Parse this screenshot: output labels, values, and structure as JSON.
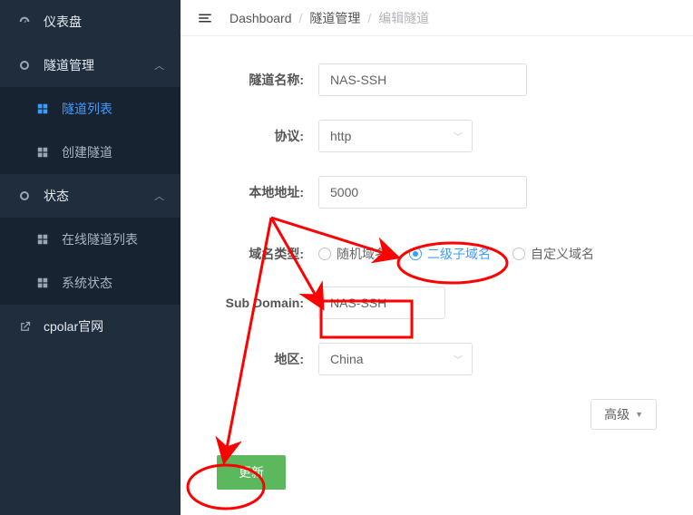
{
  "sidebar": {
    "dashboard": "仪表盘",
    "tunnel_group": "隧道管理",
    "tunnel_list": "隧道列表",
    "tunnel_create": "创建隧道",
    "status_group": "状态",
    "status_online": "在线隧道列表",
    "status_system": "系统状态",
    "ext_site": "cpolar官网"
  },
  "breadcrumb": {
    "a": "Dashboard",
    "b": "隧道管理",
    "c": "编辑隧道"
  },
  "form": {
    "name_label": "隧道名称:",
    "name_value": "NAS-SSH",
    "proto_label": "协议:",
    "proto_value": "http",
    "local_label": "本地地址:",
    "local_value": "5000",
    "domain_type_label": "域名类型:",
    "domain_opts": {
      "random": "随机域名",
      "sub": "二级子域名",
      "custom": "自定义域名"
    },
    "subdomain_label": "Sub Domain:",
    "subdomain_value": "NAS-SSH",
    "region_label": "地区:",
    "region_value": "China",
    "advanced": "高级",
    "submit": "更新"
  }
}
